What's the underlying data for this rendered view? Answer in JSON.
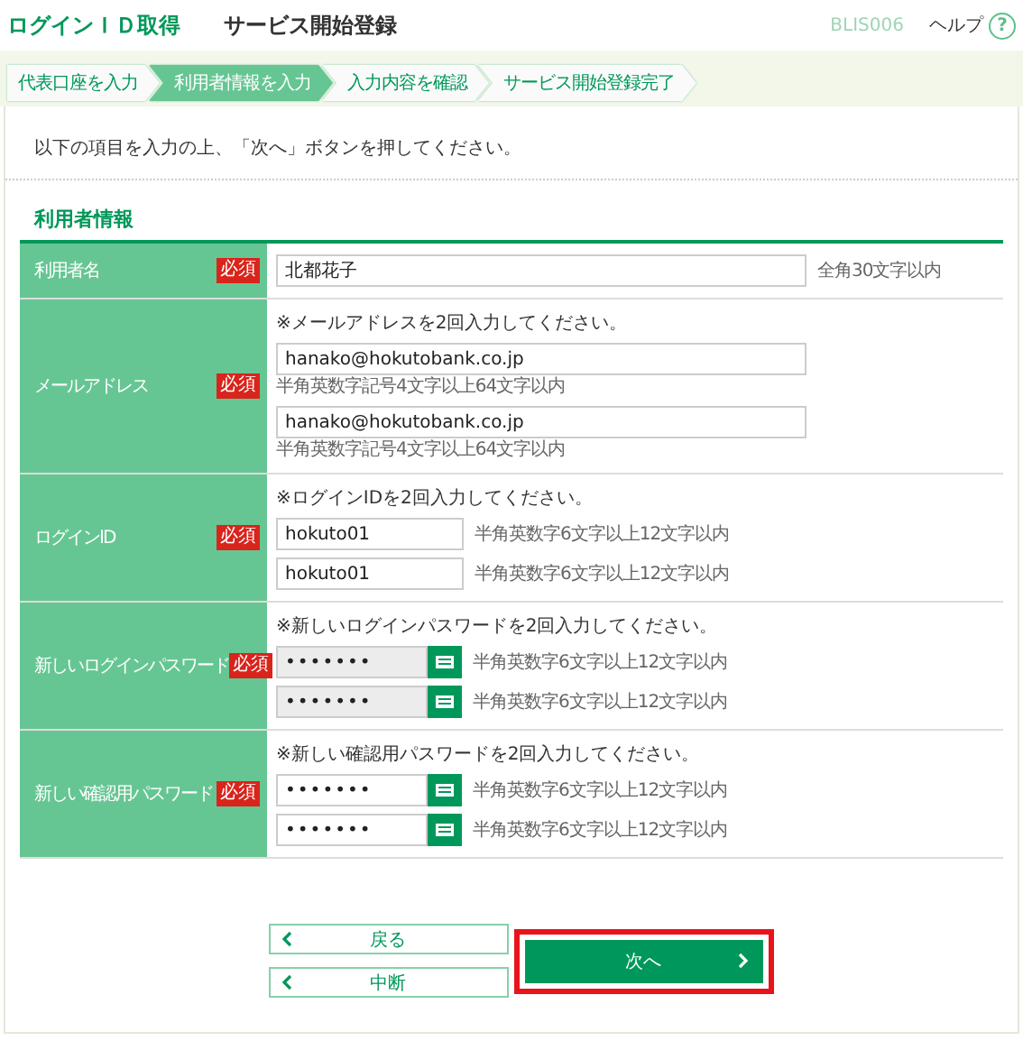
{
  "header": {
    "title": "ログインＩＤ取得",
    "subtitle": "サービス開始登録",
    "screen_id": "BLIS006",
    "help": "ヘルプ",
    "help_icon": "?"
  },
  "steps": [
    {
      "label": "代表口座を入力",
      "selected": false
    },
    {
      "label": "利用者情報を入力",
      "selected": true
    },
    {
      "label": "入力内容を確認",
      "selected": false
    },
    {
      "label": "サービス開始登録完了",
      "selected": false
    }
  ],
  "instruction": "以下の項目を入力の上、「次へ」ボタンを押してください。",
  "section_title": "利用者情報",
  "rows": [
    {
      "label": "利用者名",
      "required": true,
      "required_label": "必須",
      "kind": "single",
      "fields": [
        {
          "kind": "text",
          "value": "北都花子",
          "disabled": false,
          "hint": "全角30文字以内"
        }
      ]
    },
    {
      "label": "メールアドレス",
      "required": true,
      "required_label": "必須",
      "note": "※メールアドレスを2回入力してください。",
      "kind": "stacked",
      "fields": [
        {
          "kind": "text",
          "value": "hanako@hokutobank.co.jp",
          "disabled": false,
          "hint": "半角英数字記号4文字以上64文字以内"
        },
        {
          "kind": "text",
          "value": "hanako@hokutobank.co.jp",
          "disabled": false,
          "hint": "半角英数字記号4文字以上64文字以内"
        }
      ]
    },
    {
      "label": "ログインID",
      "required": true,
      "required_label": "必須",
      "note": "※ログインIDを2回入力してください。",
      "kind": "pair",
      "fields": [
        {
          "kind": "text",
          "value": "hokuto01",
          "disabled": false,
          "hint": "半角英数字6文字以上12文字以内"
        },
        {
          "kind": "text",
          "value": "hokuto01",
          "disabled": false,
          "hint": "半角英数字6文字以上12文字以内"
        }
      ]
    },
    {
      "label": "新しいログインパスワード",
      "required": true,
      "required_label": "必須",
      "note": "※新しいログインパスワードを2回入力してください。",
      "kind": "pair",
      "fields": [
        {
          "kind": "password",
          "value": "•••••••",
          "disabled": true,
          "hint": "半角英数字6文字以上12文字以内"
        },
        {
          "kind": "password",
          "value": "•••••••",
          "disabled": true,
          "hint": "半角英数字6文字以上12文字以内"
        }
      ]
    },
    {
      "label": "新しい確認用パスワード",
      "required": true,
      "required_label": "必須",
      "note": "※新しい確認用パスワードを2回入力してください。",
      "kind": "pair",
      "fields": [
        {
          "kind": "password",
          "value": "•••••••",
          "disabled": false,
          "hint": "半角英数字6文字以上12文字以内"
        },
        {
          "kind": "password",
          "value": "•••••••",
          "disabled": false,
          "hint": "半角英数字6文字以上12文字以内"
        }
      ]
    }
  ],
  "buttons": [
    {
      "kind": "secondary",
      "label": "戻る",
      "highlighted": false
    },
    {
      "kind": "secondary",
      "label": "中断",
      "highlighted": false
    },
    {
      "kind": "primary",
      "label": "次へ",
      "highlighted": true
    }
  ]
}
